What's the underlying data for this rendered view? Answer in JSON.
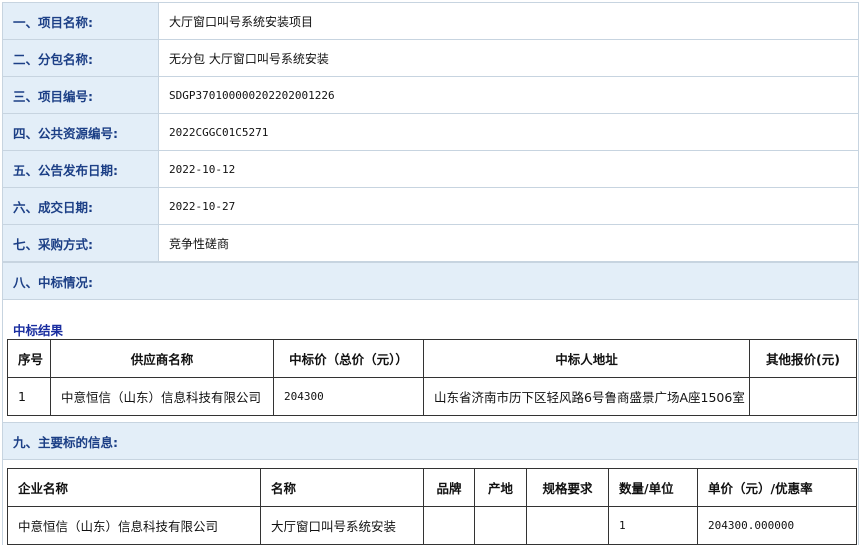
{
  "info_rows": [
    {
      "label": "一、项目名称:",
      "value": "大厅窗口叫号系统安装项目"
    },
    {
      "label": "二、分包名称:",
      "value": "无分包 大厅窗口叫号系统安装"
    },
    {
      "label": "三、项目编号:",
      "value": "SDGP370100000202202001226"
    },
    {
      "label": "四、公共资源编号:",
      "value": "2022CGGC01C5271"
    },
    {
      "label": "五、公告发布日期:",
      "value": "2022-10-12"
    },
    {
      "label": "六、成交日期:",
      "value": "2022-10-27"
    },
    {
      "label": "七、采购方式:",
      "value": "竞争性磋商"
    }
  ],
  "section8": {
    "label": "八、中标情况:"
  },
  "award": {
    "title": "中标结果",
    "headers": [
      "序号",
      "供应商名称",
      "中标价（总价（元））",
      "中标人地址",
      "其他报价(元)"
    ],
    "rows": [
      [
        "1",
        "中意恒信（山东）信息科技有限公司",
        "204300",
        "山东省济南市历下区轻风路6号鲁商盛景广场A座1506室",
        ""
      ]
    ]
  },
  "section9": {
    "label": "九、主要标的信息:"
  },
  "items": {
    "headers": [
      "企业名称",
      "名称",
      "品牌",
      "产地",
      "规格要求",
      "数量/单位",
      "单价（元）/优惠率"
    ],
    "rows": [
      [
        "中意恒信（山东）信息科技有限公司",
        "大厅窗口叫号系统安装",
        "",
        "",
        "",
        "1",
        "204300.000000"
      ]
    ]
  }
}
